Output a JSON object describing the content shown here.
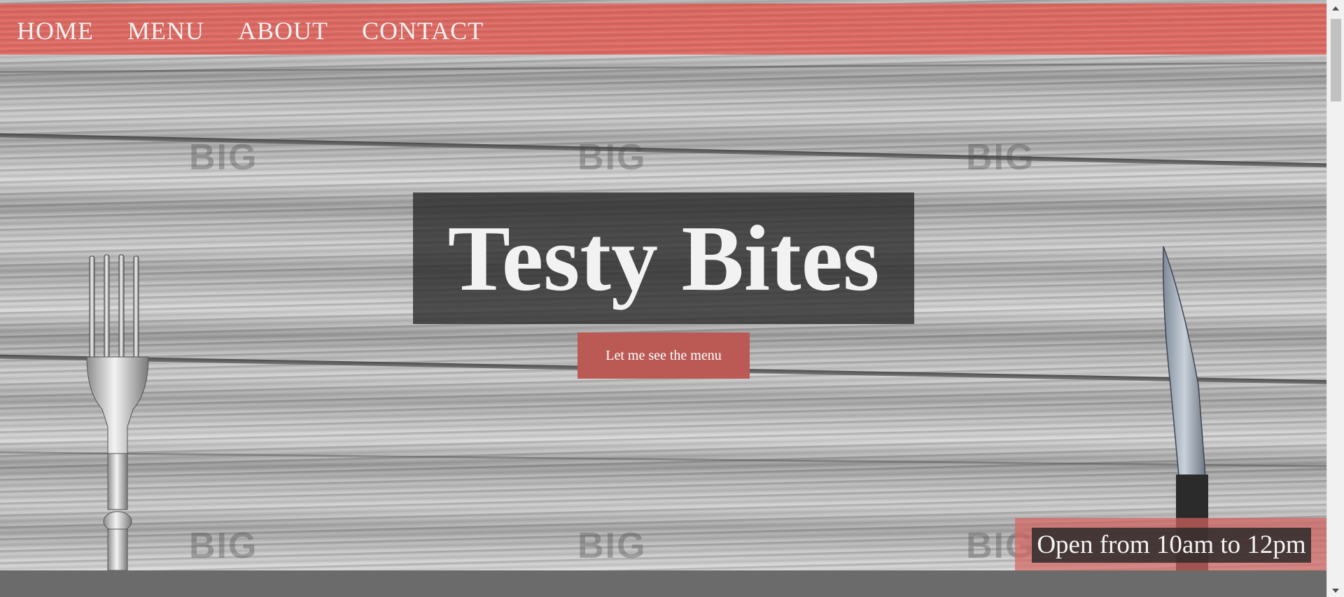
{
  "nav": {
    "items": [
      {
        "label": "HOME"
      },
      {
        "label": "MENU"
      },
      {
        "label": "ABOUT"
      },
      {
        "label": "CONTACT"
      }
    ]
  },
  "hero": {
    "title": "Testy Bites",
    "cta_label": "Let me see the menu",
    "hours": "Open from 10am to 12pm",
    "watermark": "BIG"
  },
  "colors": {
    "nav_bar": "#e56860",
    "cta_button": "#bb5a55",
    "title_box": "#282828",
    "footer": "#6b6b6b"
  },
  "icons": [
    "fork-icon",
    "knife-icon"
  ]
}
